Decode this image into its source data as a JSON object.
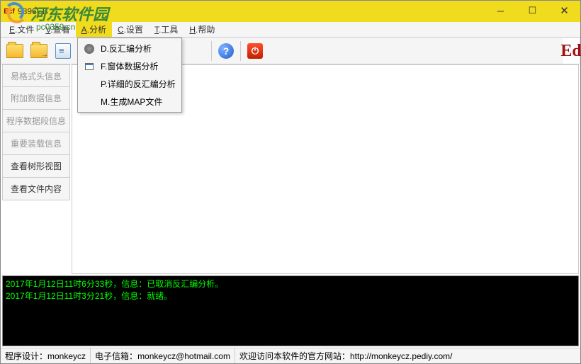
{
  "window": {
    "title": "9896EB",
    "icon_text": "Ecf"
  },
  "watermark": {
    "text": "河东软件园",
    "url": "pc0359.cn"
  },
  "menu": {
    "file": "E.文件",
    "view": "V.查看",
    "analyze": "A.分析",
    "config": "C.设置",
    "tools": "T.工具",
    "help": "H.帮助"
  },
  "dropdown": {
    "items": [
      "D.反汇编分析",
      "F.窗体数据分析",
      "P.详细的反汇编分析",
      "M.生成MAP文件"
    ]
  },
  "sidebar": {
    "items": [
      "易格式头信息",
      "附加数据信息",
      "程序数据段信息",
      "重要装载信息",
      "查看树形视图",
      "查看文件内容"
    ]
  },
  "right_logo": "Ed",
  "console": {
    "lines": [
      "2017年1月12日11时6分33秒，信息：已取消反汇编分析。",
      "2017年1月12日11时3分21秒，信息：就绪。"
    ]
  },
  "statusbar": {
    "designer_label": "程序设计：",
    "designer_value": "monkeycz",
    "email_label": "电子信箱：",
    "email_value": "monkeycz@hotmail.com",
    "website_label": "欢迎访问本软件的官方网站：",
    "website_value": "http://monkeycz.pediy.com/"
  }
}
